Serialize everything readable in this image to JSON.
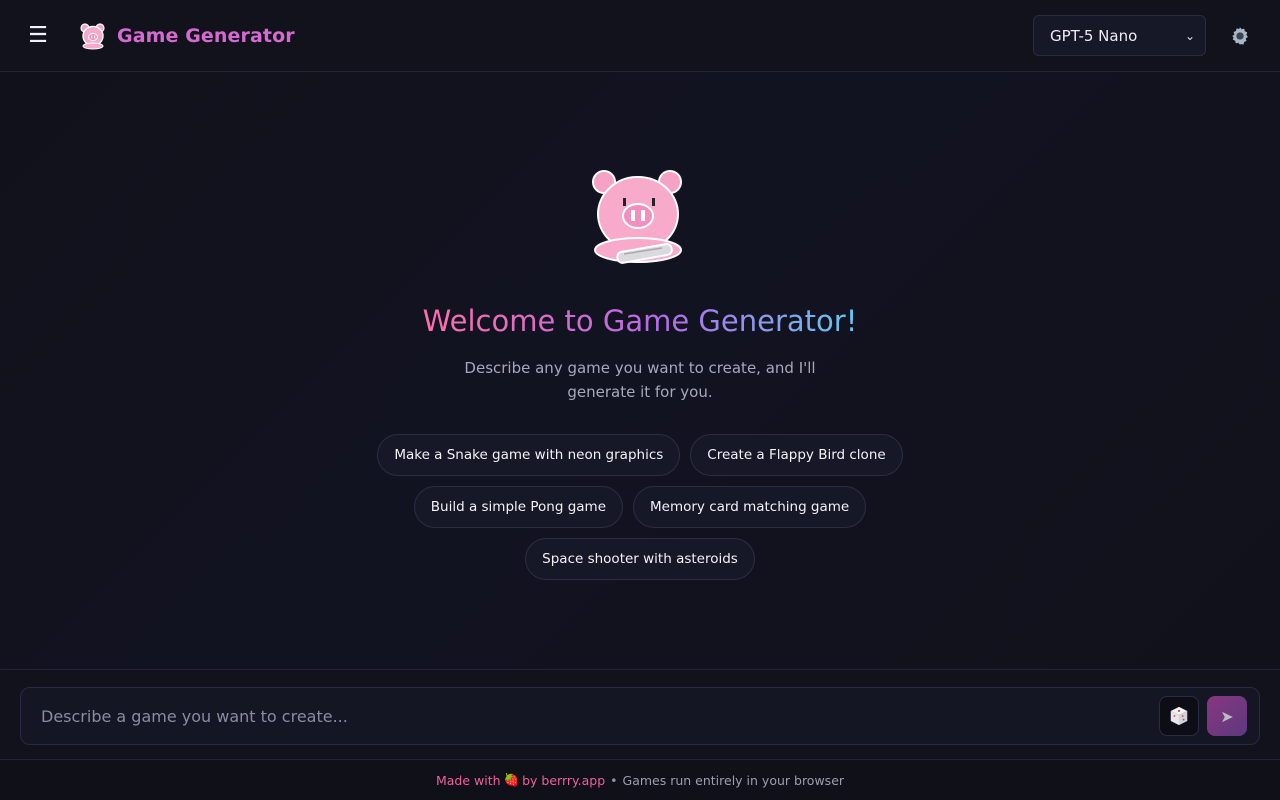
{
  "header": {
    "menu_icon": "hamburger-menu-icon",
    "logo_icon": "pig-logo-icon",
    "title": "Game Generator",
    "model": {
      "selected": "GPT-5 Nano",
      "options": [
        "GPT-5 Nano"
      ]
    },
    "settings_icon": "gear-icon"
  },
  "welcome": {
    "mascot_icon": "pig-mascot-icon",
    "title": "Welcome to Game Generator!",
    "subtitle": "Describe any game you want to create, and I'll generate it for you."
  },
  "suggestions": [
    "Make a Snake game with neon graphics",
    "Create a Flappy Bird clone",
    "Build a simple Pong game",
    "Memory card matching game",
    "Space shooter with asteroids"
  ],
  "composer": {
    "placeholder": "Describe a game you want to create...",
    "value": "",
    "dice_icon": "dice-icon",
    "send_icon": "send-icon"
  },
  "footer": {
    "made_with": "Made with",
    "heart_icon": "strawberry-icon",
    "by_text": "by berrry.app",
    "separator": "•",
    "tagline": "Games run entirely in your browser"
  },
  "colors": {
    "background": "#101019",
    "accent_pink": "#d56ad1",
    "footer_pink": "#ef5f9c",
    "send_button": "#9b3d8f"
  }
}
